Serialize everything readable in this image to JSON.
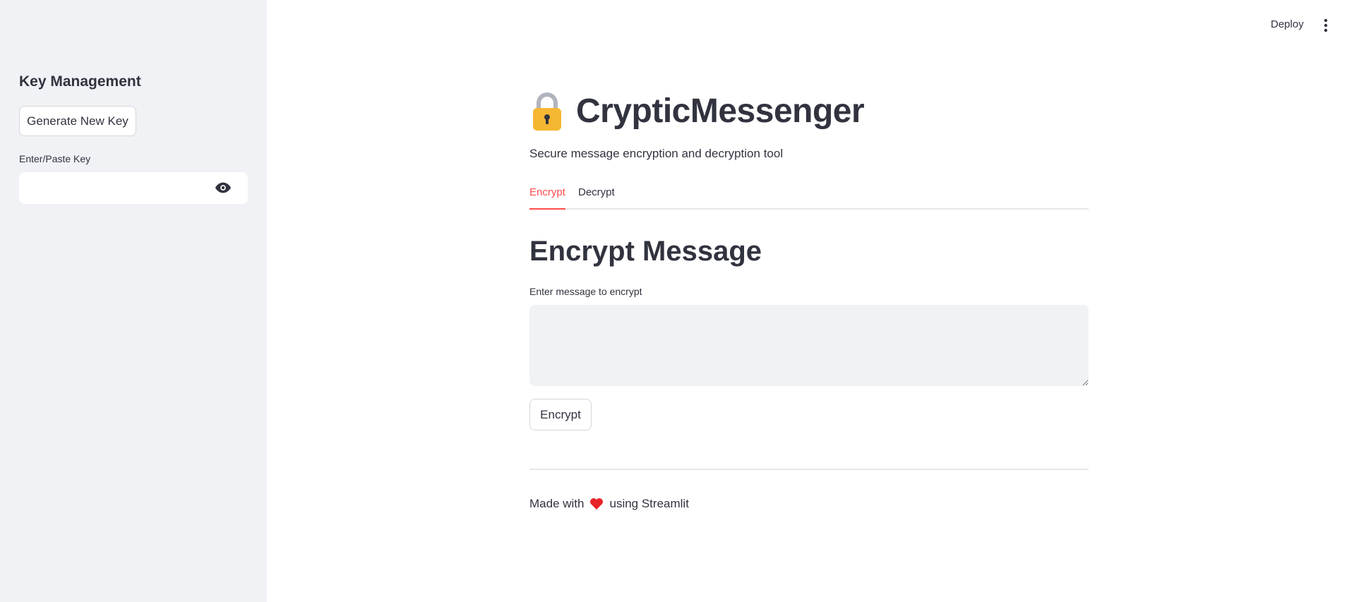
{
  "sidebar": {
    "title": "Key Management",
    "generate_button": "Generate New Key",
    "key_label": "Enter/Paste Key",
    "key_value": "",
    "icons": {
      "visibility": "eye-icon"
    }
  },
  "header": {
    "deploy": "Deploy",
    "menu_icon": "vertical-dots-icon"
  },
  "main": {
    "title_icon": "lock-icon",
    "title": "CrypticMessenger",
    "subtitle": "Secure message encryption and decryption tool",
    "tabs": [
      {
        "label": "Encrypt",
        "active": true
      },
      {
        "label": "Decrypt",
        "active": false
      }
    ],
    "section_title": "Encrypt Message",
    "message_label": "Enter message to encrypt",
    "message_value": "",
    "encrypt_button": "Encrypt",
    "footer": {
      "prefix": "Made with",
      "icon": "heart-icon",
      "suffix": "using Streamlit"
    }
  },
  "colors": {
    "accent": "#ff4b4b",
    "sidebar_bg": "#f0f2f6",
    "text": "#31333f",
    "lock": "#f5b731"
  }
}
